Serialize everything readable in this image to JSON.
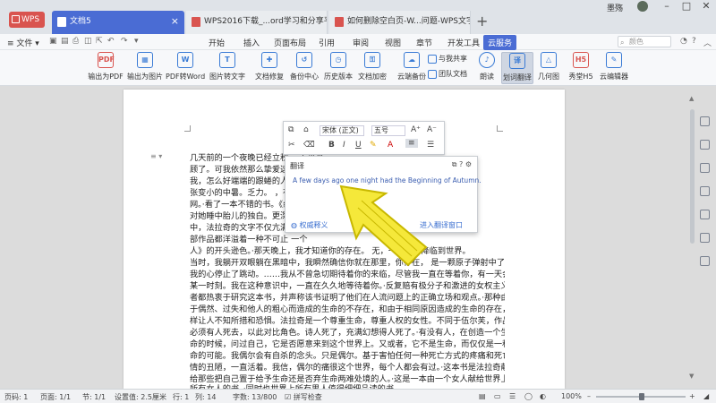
{
  "tabs": [
    {
      "label": "WPS"
    },
    {
      "label": "文档5"
    },
    {
      "label": "WPS2016下载_...ord学习和分享平台"
    },
    {
      "label": "如何删除空白页-W...问题-WPS文字-"
    }
  ],
  "user": {
    "name": "墨殇"
  },
  "menu": {
    "file": "文件",
    "items": [
      "开始",
      "插入",
      "页面布局",
      "引用",
      "审阅",
      "视图",
      "章节",
      "开发工具",
      "云服务"
    ],
    "search_placeholder": "颜色"
  },
  "toolbar": {
    "buttons": [
      {
        "label": "输出为PDF",
        "icon": "pdf-export-icon",
        "color": "#d9544f",
        "glyph": "PDF"
      },
      {
        "label": "输出为图片",
        "icon": "image-export-icon",
        "color": "#3a7bd5",
        "glyph": "IMG"
      },
      {
        "label": "PDF转Word",
        "icon": "pdf-to-word-icon",
        "color": "#3a7bd5",
        "glyph": "W"
      },
      {
        "label": "图片转文字",
        "icon": "image-to-text-icon",
        "color": "#3a7bd5",
        "glyph": "T"
      },
      {
        "label": "文档修复",
        "icon": "repair-icon",
        "color": "#3a7bd5",
        "glyph": "✚"
      },
      {
        "label": "备份中心",
        "icon": "backup-icon",
        "color": "#3a7bd5",
        "glyph": "↺"
      },
      {
        "label": "历史版本",
        "icon": "history-icon",
        "color": "#3a7bd5",
        "glyph": "◷"
      },
      {
        "label": "文档加密",
        "icon": "lock-icon",
        "color": "#3a7bd5",
        "glyph": "🔒"
      },
      {
        "label": "云端备份",
        "icon": "cloud-backup-icon",
        "color": "#3a7bd5",
        "glyph": "☁"
      },
      {
        "label": "朗读",
        "icon": "read-aloud-icon",
        "color": "#3a7bd5",
        "glyph": "♪"
      },
      {
        "label": "划词翻译",
        "icon": "translate-icon",
        "color": "#3a7bd5",
        "glyph": "译"
      },
      {
        "label": "几何图",
        "icon": "geometry-icon",
        "color": "#3a7bd5",
        "glyph": "△"
      },
      {
        "label": "秀堂H5",
        "icon": "h5-icon",
        "color": "#d9544f",
        "glyph": "H5"
      },
      {
        "label": "云编辑器",
        "icon": "cloud-editor-icon",
        "color": "#3a7bd5",
        "glyph": "✎"
      }
    ],
    "share_label": "与我共享",
    "team_label": "团队文档"
  },
  "format_bar": {
    "font": "宋体 (正文)",
    "size": "五号"
  },
  "translation": {
    "title": "翻译",
    "text": "A few days ago one night had the Beginning of Autumn.",
    "link_left": "权威释义",
    "link_right": "进入翻译窗口"
  },
  "document": {
    "lines": [
      "几天前的一个夜晚已经立秋。                                       上来光",
      "顾了。可我依然那么挚爱这                                         能了中",
      "我，怎么好端端的跟蜷的人了？                                      你着一",
      "张变小的中暑。乏力。                                              ，有着",
      "网。·看了一本不错的书。《纟                                      路边上",
      "对她睡中胎儿的独白。更深                                          开者中",
      "中，法拉奇的文字不仅亢满                                          《信》",
      "部作品都洋溢着一种不可止                                          一个",
      "人》的开头逊色。·那天晚上，我才知道你的存在。                    无，一个生命降临到世界。",
      "当时，我躺开双眼躺在黑暗中，我瞬然确信你就在那里，你存在，         是一颗原子弹射中了我，",
      "我的心停止了跳动。……我从不曾急切期待着你的来临，尽管我一直在等着你，有一天会存在于",
      "某一时刻。我在这种意识中，一直在久久地等待着你。·反复赔有极分子和激进的女权主义",
      "者都热衷于研究这本书，并声称该书证明了他们在人流问题上的正确立场和观点。·那种由",
      "于偶然、过失和他人的粗心而造成的生命的不存在，和由于相同原因造成的生命的存在，同",
      "样让人不知所措和恐惧。法拉奇是一个尊重生命，尊重人权的女性。不同于伍尔芙，作品中",
      "必须有人死去，以此对比角色。诗人死了，充满幻想得人死了。·有没有人，在创造一个生",
      "命的时候，问过自己，它是否愿意来到这个世界上。又或者，它不是生命，而仅仅是一种生",
      "命的可能。我偶尔会有自杀的念头。只是偶尔。基于害怕任何一种死亡方式的疼痛和死亡表",
      "情的丑陋，一直活着。我信，偶尔的痛很这个世界，每个人都会有过。·这本书是法拉奇献",
      "给那些把自己置于给予生命还是否弃生命两难处境的人。·这是一本由一个女人献给世界上",
      "所有女人的书，·同时也世界上所有男人值得细细品读的书。"
    ]
  },
  "status": {
    "page": "页码: 1",
    "pages": "页面: 1/1",
    "section": "节: 1/1",
    "position": "设置值: 2.5厘米",
    "row": "行: 1",
    "col": "列: 14",
    "words": "字数: 13/800",
    "spellcheck": "拼写检查",
    "zoom": "100%"
  }
}
